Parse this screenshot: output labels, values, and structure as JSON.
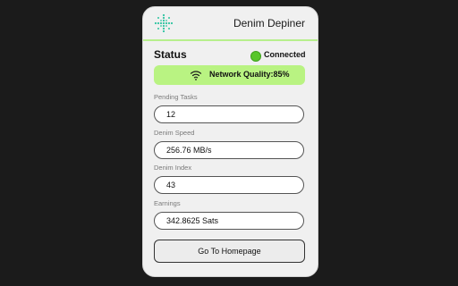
{
  "app": {
    "title": "Denim Depiner",
    "logo_icon": "dotted-cross-logo"
  },
  "status": {
    "label": "Status",
    "state_text": "Connected",
    "state_color": "#58c62b"
  },
  "network": {
    "icon": "wifi-icon",
    "text": "Network Quality:85%",
    "quality_percent": 85,
    "accent_color": "#b9f382"
  },
  "fields": [
    {
      "label": "Pending Tasks",
      "value": "12"
    },
    {
      "label": "Denim Speed",
      "value": "256.76 MB/s"
    },
    {
      "label": "Denim Index",
      "value": "43"
    },
    {
      "label": "Earnings",
      "value": "342.8625 Sats"
    }
  ],
  "actions": {
    "homepage_label": "Go To Homepage"
  }
}
